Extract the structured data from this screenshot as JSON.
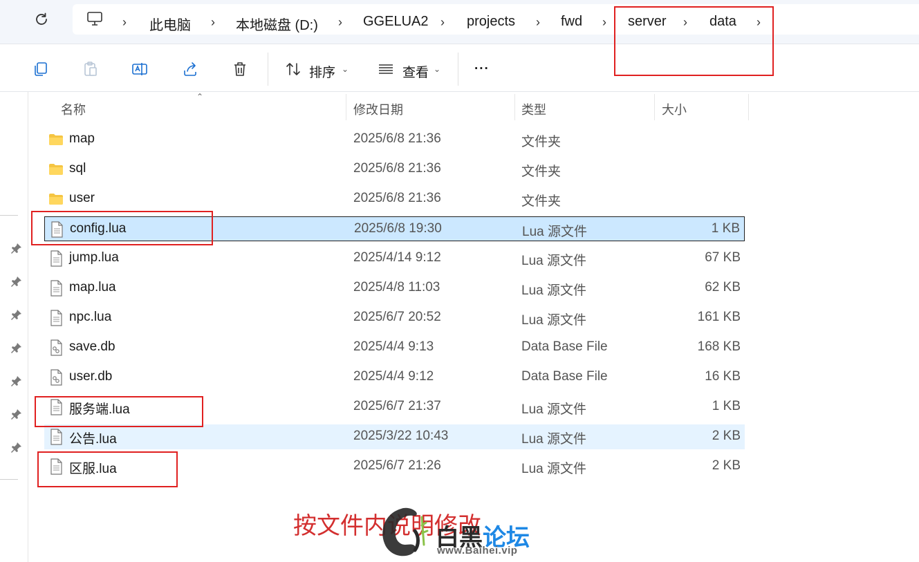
{
  "breadcrumb": {
    "items": [
      "此电脑",
      "本地磁盘 (D:)",
      "GGELUA2",
      "projects",
      "fwd",
      "server",
      "data"
    ]
  },
  "toolbar": {
    "sort_label": "排序",
    "view_label": "查看",
    "more_label": "..."
  },
  "columns": {
    "name": "名称",
    "date": "修改日期",
    "type": "类型",
    "size": "大小"
  },
  "files": [
    {
      "name": "map",
      "date": "2025/6/8 21:36",
      "type": "文件夹",
      "size": "",
      "icon": "folder-icon"
    },
    {
      "name": "sql",
      "date": "2025/6/8 21:36",
      "type": "文件夹",
      "size": "",
      "icon": "folder-icon"
    },
    {
      "name": "user",
      "date": "2025/6/8 21:36",
      "type": "文件夹",
      "size": "",
      "icon": "folder-icon"
    },
    {
      "name": "config.lua",
      "date": "2025/6/8 19:30",
      "type": "Lua 源文件",
      "size": "1 KB",
      "icon": "text-file-icon"
    },
    {
      "name": "jump.lua",
      "date": "2025/4/14 9:12",
      "type": "Lua 源文件",
      "size": "67 KB",
      "icon": "text-file-icon"
    },
    {
      "name": "map.lua",
      "date": "2025/4/8 11:03",
      "type": "Lua 源文件",
      "size": "62 KB",
      "icon": "text-file-icon"
    },
    {
      "name": "npc.lua",
      "date": "2025/6/7 20:52",
      "type": "Lua 源文件",
      "size": "161 KB",
      "icon": "text-file-icon"
    },
    {
      "name": "save.db",
      "date": "2025/4/4 9:13",
      "type": "Data Base File",
      "size": "168 KB",
      "icon": "db-file-icon"
    },
    {
      "name": "user.db",
      "date": "2025/4/4 9:12",
      "type": "Data Base File",
      "size": "16 KB",
      "icon": "db-file-icon"
    },
    {
      "name": "服务端.lua",
      "date": "2025/6/7 21:37",
      "type": "Lua 源文件",
      "size": "1 KB",
      "icon": "text-file-icon"
    },
    {
      "name": "公告.lua",
      "date": "2025/3/22 10:43",
      "type": "Lua 源文件",
      "size": "2 KB",
      "icon": "text-file-icon"
    },
    {
      "name": "区服.lua",
      "date": "2025/6/7 21:26",
      "type": "Lua 源文件",
      "size": "2 KB",
      "icon": "text-file-icon"
    }
  ],
  "annotation": "按文件内说明修改",
  "watermark": {
    "title_a": "白黑",
    "title_b": "论坛",
    "url": "www.Baihei.vip"
  },
  "colors": {
    "highlight_box": "#e02020",
    "selected_row": "#cce8ff",
    "hover_row": "#e5f3ff",
    "annotation_text": "#d32f2f",
    "watermark_blue": "#1e88e5"
  }
}
